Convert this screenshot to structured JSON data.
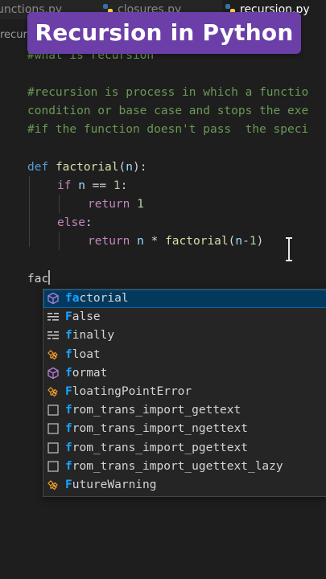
{
  "tabs": [
    {
      "label": "unctions.py",
      "active": false
    },
    {
      "label": "closures.py",
      "active": false
    },
    {
      "label": "recursion.py",
      "active": true
    }
  ],
  "breadcrumb": "recurs",
  "banner": {
    "title": "Recursion in Python"
  },
  "code": {
    "comment1": "#what is recursion",
    "comment2": "#recursion is process in which a functio",
    "comment3": "condition or base case and stops the exe",
    "comment4": "#if the function doesn't pass  the speci",
    "def_kw": "def",
    "func_name": "factorial",
    "open_paren": "(",
    "param": "n",
    "close_paren_colon": "):",
    "if_kw": "if",
    "if_var": "n",
    "if_op": " == ",
    "if_num": "1",
    "colon1": ":",
    "return_kw": "return",
    "return_num": "1",
    "else_kw": "else",
    "colon2": ":",
    "return_kw2": "return",
    "ret2_var": "n",
    "ret2_op": " * ",
    "ret2_fn": "factorial",
    "ret2_open": "(",
    "ret2_arg": "n",
    "ret2_rest": "-",
    "ret2_num": "1",
    "ret2_close": ")",
    "typed": "fac"
  },
  "suggestions": [
    {
      "icon": "method-cube-icon",
      "match": "fa",
      "rest": "ctorial",
      "selected": true
    },
    {
      "icon": "keyword-icon",
      "match": "F",
      "rest": "alse",
      "selected": false
    },
    {
      "icon": "keyword-icon",
      "match": "f",
      "rest": "inally",
      "selected": false
    },
    {
      "icon": "class-icon",
      "match": "f",
      "rest": "loat",
      "selected": false
    },
    {
      "icon": "method-cube-icon",
      "match": "f",
      "rest": "ormat",
      "selected": false
    },
    {
      "icon": "class-icon",
      "match": "F",
      "rest": "loatingPointError",
      "selected": false
    },
    {
      "icon": "snippet-box-icon",
      "match": "f",
      "rest": "rom_trans_import_gettext",
      "selected": false
    },
    {
      "icon": "snippet-box-icon",
      "match": "f",
      "rest": "rom_trans_import_ngettext",
      "selected": false
    },
    {
      "icon": "snippet-box-icon",
      "match": "f",
      "rest": "rom_trans_import_pgettext",
      "selected": false
    },
    {
      "icon": "snippet-box-icon",
      "match": "f",
      "rest": "rom_trans_import_ugettext_lazy",
      "selected": false
    },
    {
      "icon": "class-icon",
      "match": "F",
      "rest": "utureWarning",
      "selected": false
    }
  ],
  "colors": {
    "banner_bg": "#6b3fa7",
    "editor_bg": "#1e1e1e",
    "comment": "#6a9955",
    "keyword": "#c586c0",
    "function": "#dcdcaa",
    "match_highlight": "#18a3ff"
  }
}
